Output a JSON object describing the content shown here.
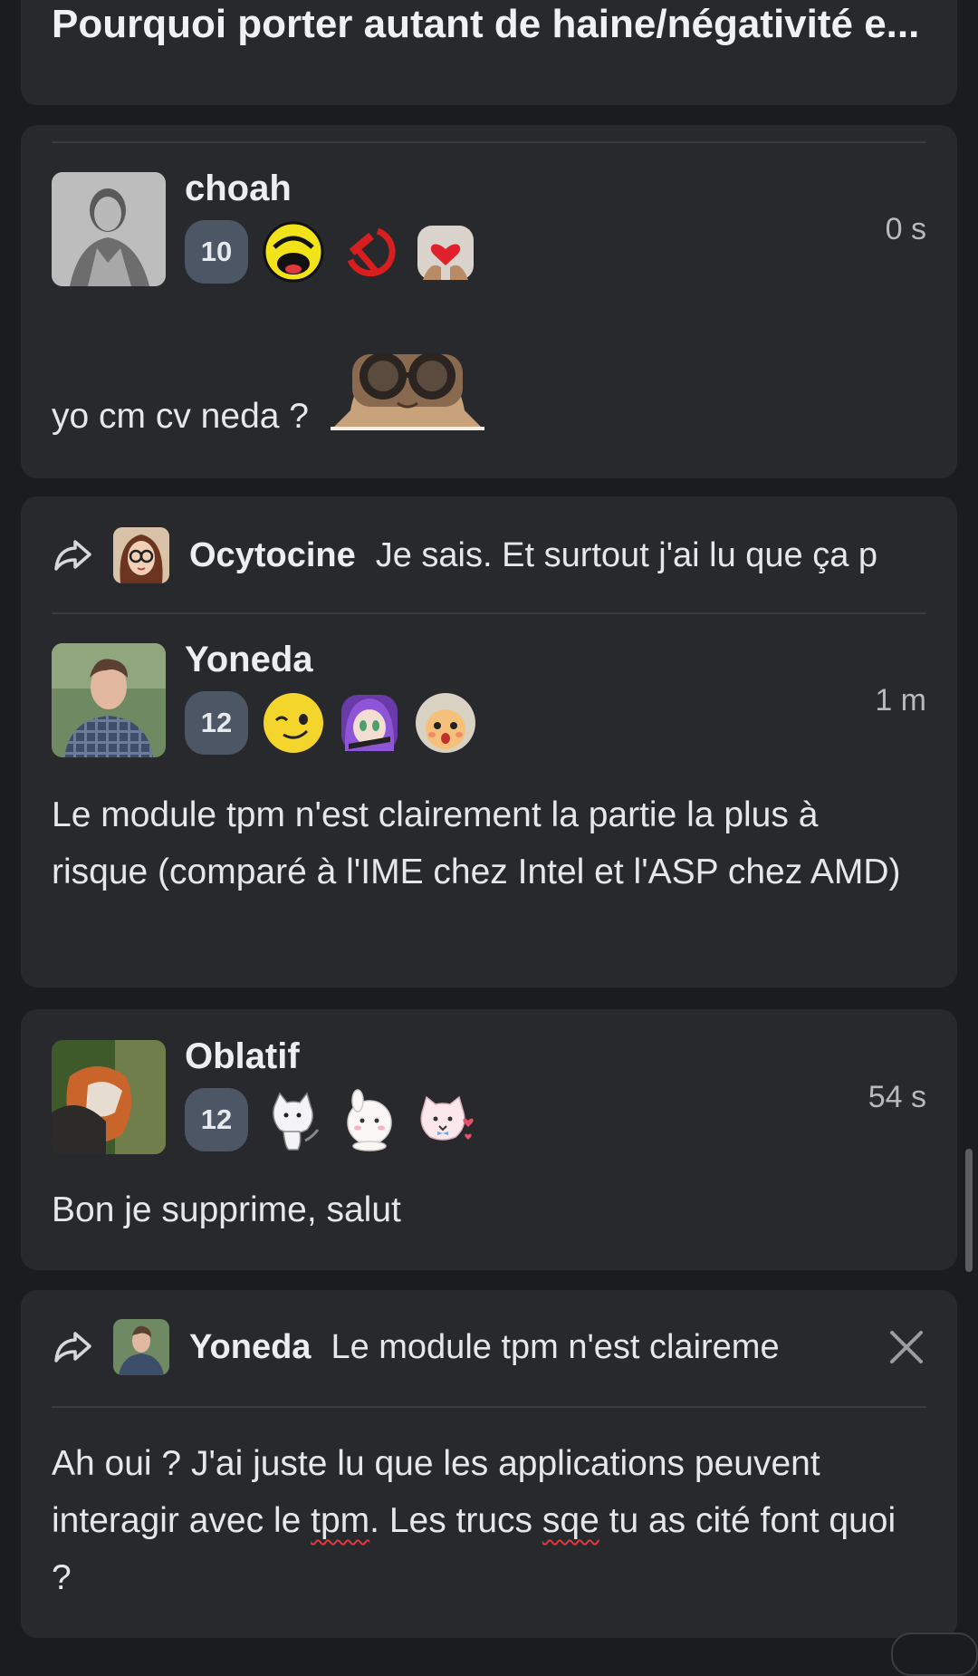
{
  "topic": {
    "title": "Pourquoi porter autant de haine/négativité e..."
  },
  "posts": [
    {
      "username": "choah",
      "level": "10",
      "time": "0 s",
      "message": "yo cm cv neda ?",
      "badges": [
        "laughing-emoji-icon",
        "hammer-sickle-icon",
        "heart-hands-icon"
      ],
      "sticker": "cat-glasses-sticker"
    },
    {
      "reply_to": {
        "username": "Ocytocine",
        "snippet": "Je sais. Et surtout j'ai lu que ça p"
      },
      "username": "Yoneda",
      "level": "12",
      "time": "1 m",
      "message": "Le module tpm n'est clairement la partie la plus à risque (comparé à l'IME chez Intel et l'ASP chez AMD)",
      "badges": [
        "smiling-face-icon",
        "anime-girl-icon",
        "crying-doll-icon"
      ]
    },
    {
      "username": "Oblatif",
      "level": "12",
      "time": "54 s",
      "message": "Bon je supprime, salut",
      "badges": [
        "waving-cat-icon",
        "bunny-icon",
        "cat-hearts-icon"
      ]
    }
  ],
  "composer": {
    "reply_to": {
      "username": "Yoneda",
      "snippet": "Le module tpm n'est claireme"
    },
    "text_parts": [
      "Ah oui ? J'ai juste lu que les applications peuvent interagir avec le ",
      "tpm",
      ". Les trucs ",
      "sqe",
      " tu as cité font quoi ?"
    ]
  },
  "colors": {
    "background": "#1b1c1f",
    "card": "#28292d",
    "level_badge": "#4c5665",
    "spellcheck": "#e0383e"
  }
}
